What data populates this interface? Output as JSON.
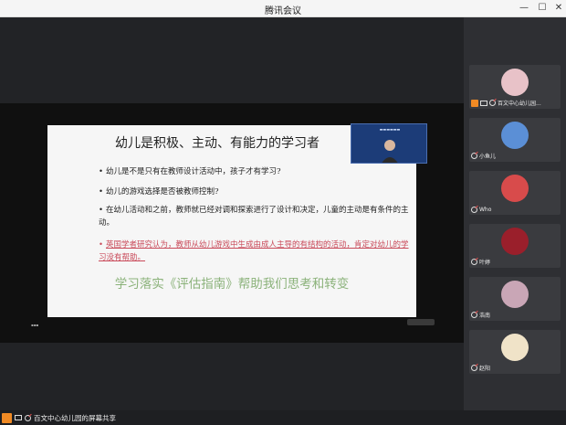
{
  "window": {
    "title": "腾讯会议"
  },
  "slide": {
    "title": "幼儿是积极、主动、有能力的学习者",
    "bullets": [
      "幼儿是不是只有在教师设计活动中，孩子才有学习?",
      "幼儿的游戏选择是否被教师控制?",
      "在幼儿活动和之前，教师就已经对调和探索进行了设计和决定，儿童的主动是有条件的主动。",
      "英国学者研究认为，教师从幼儿游戏中生成由成人主导的有结构的活动，肯定对幼儿的学习没有帮助。"
    ],
    "footer": "学习落实《评估指南》帮助我们思考和转变",
    "highlight_color": "#c94a5a"
  },
  "participants": [
    {
      "name": "百文中心幼儿园...",
      "avatar_color": "#e8c2c8",
      "icon": "cartoon-girl-icon",
      "host": true
    },
    {
      "name": "小鱼儿",
      "avatar_color": "#5b8fd6",
      "icon": "rabbit-icon",
      "host": false
    },
    {
      "name": "Who",
      "avatar_color": "#d84b4b",
      "icon": "red-avatar-icon",
      "host": false
    },
    {
      "name": "叶婷",
      "avatar_color": "#9a1f2b",
      "icon": "flower-avatar-icon",
      "host": false
    },
    {
      "name": "浩南",
      "avatar_color": "#c9a6b6",
      "icon": "children-photo-icon",
      "host": false
    },
    {
      "name": "赵阳",
      "avatar_color": "#f0e3c8",
      "icon": "family-cartoon-icon",
      "host": false
    }
  ],
  "bottom": {
    "share_label": "百文中心幼儿园的屏幕共享"
  }
}
